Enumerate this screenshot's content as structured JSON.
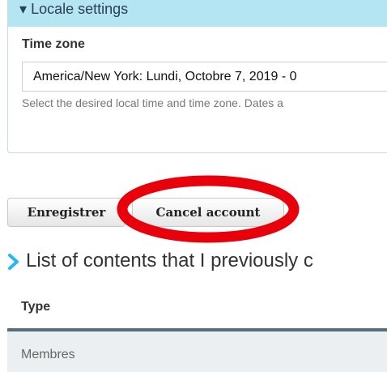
{
  "locale_settings": {
    "legend": "Locale settings",
    "time_zone_label": "Time zone",
    "time_zone_value": "America/New York: Lundi, Octobre 7, 2019 - 0",
    "time_zone_description": "Select the desired local time and time zone. Dates a"
  },
  "actions": {
    "save_label": "Enregistrer",
    "cancel_account_label": "Cancel account"
  },
  "annotation": {
    "highlight_color": "#e8000b"
  },
  "contents_section": {
    "title": "List of contents that I previously c",
    "columns": [
      "Type"
    ],
    "rows": [
      {
        "type": "Membres"
      }
    ]
  },
  "colors": {
    "accent": "#29b6f6",
    "legend_background": "#b3e5f3",
    "table_rule": "#546e7a",
    "row_background": "#eceff1"
  },
  "icons": {
    "collapse": "triangle-down-icon",
    "section": "chevron-right-icon"
  }
}
